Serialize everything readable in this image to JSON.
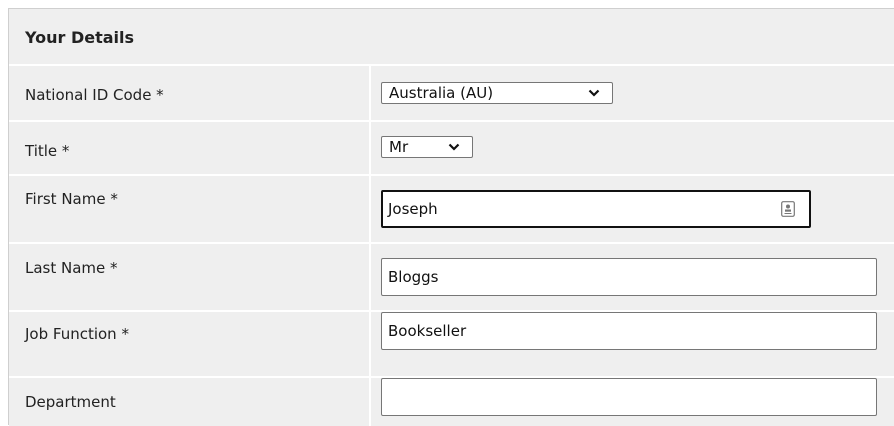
{
  "section": {
    "title": "Your Details"
  },
  "fields": {
    "national_id": {
      "label": "National ID Code *",
      "value": "Australia (AU)"
    },
    "title": {
      "label": "Title *",
      "value": "Mr"
    },
    "first_name": {
      "label": "First Name *",
      "value": "Joseph"
    },
    "last_name": {
      "label": "Last Name *",
      "value": "Bloggs"
    },
    "job_function": {
      "label": "Job Function *",
      "value": "Bookseller"
    },
    "department": {
      "label": "Department",
      "value": ""
    }
  },
  "colors": {
    "row_background": "#efefef",
    "input_border": "#767676",
    "focus_border": "#111111"
  },
  "icons": {
    "select_arrow": "chevron-down-icon",
    "autofill": "contact-card-icon"
  }
}
